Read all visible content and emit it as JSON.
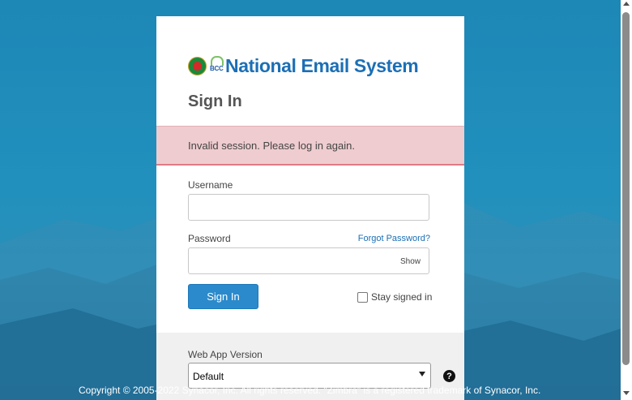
{
  "brand": {
    "logo_text": "National Email System",
    "bcc_label": "BCC"
  },
  "login": {
    "title": "Sign In",
    "error_message": "Invalid session. Please log in again.",
    "username_label": "Username",
    "username_value": "",
    "password_label": "Password",
    "password_value": "",
    "forgot_password": "Forgot Password?",
    "show_label": "Show",
    "sign_in_button": "Sign In",
    "stay_signed_in": "Stay signed in",
    "stay_signed_in_checked": false
  },
  "web_app": {
    "label": "Web App Version",
    "selected": "Default"
  },
  "footer": {
    "copyright": "Copyright © 2005-2022 Synacor, Inc. All rights reserved. \"Zimbra\" is a registered trademark of Synacor, Inc."
  },
  "icons": {
    "help": "help-icon",
    "emblem": "emblem-icon"
  },
  "colors": {
    "accent": "#2b8acb",
    "error_bg": "#efcccf",
    "error_border": "#e07b84",
    "logo_blue": "#1c6fb5"
  }
}
